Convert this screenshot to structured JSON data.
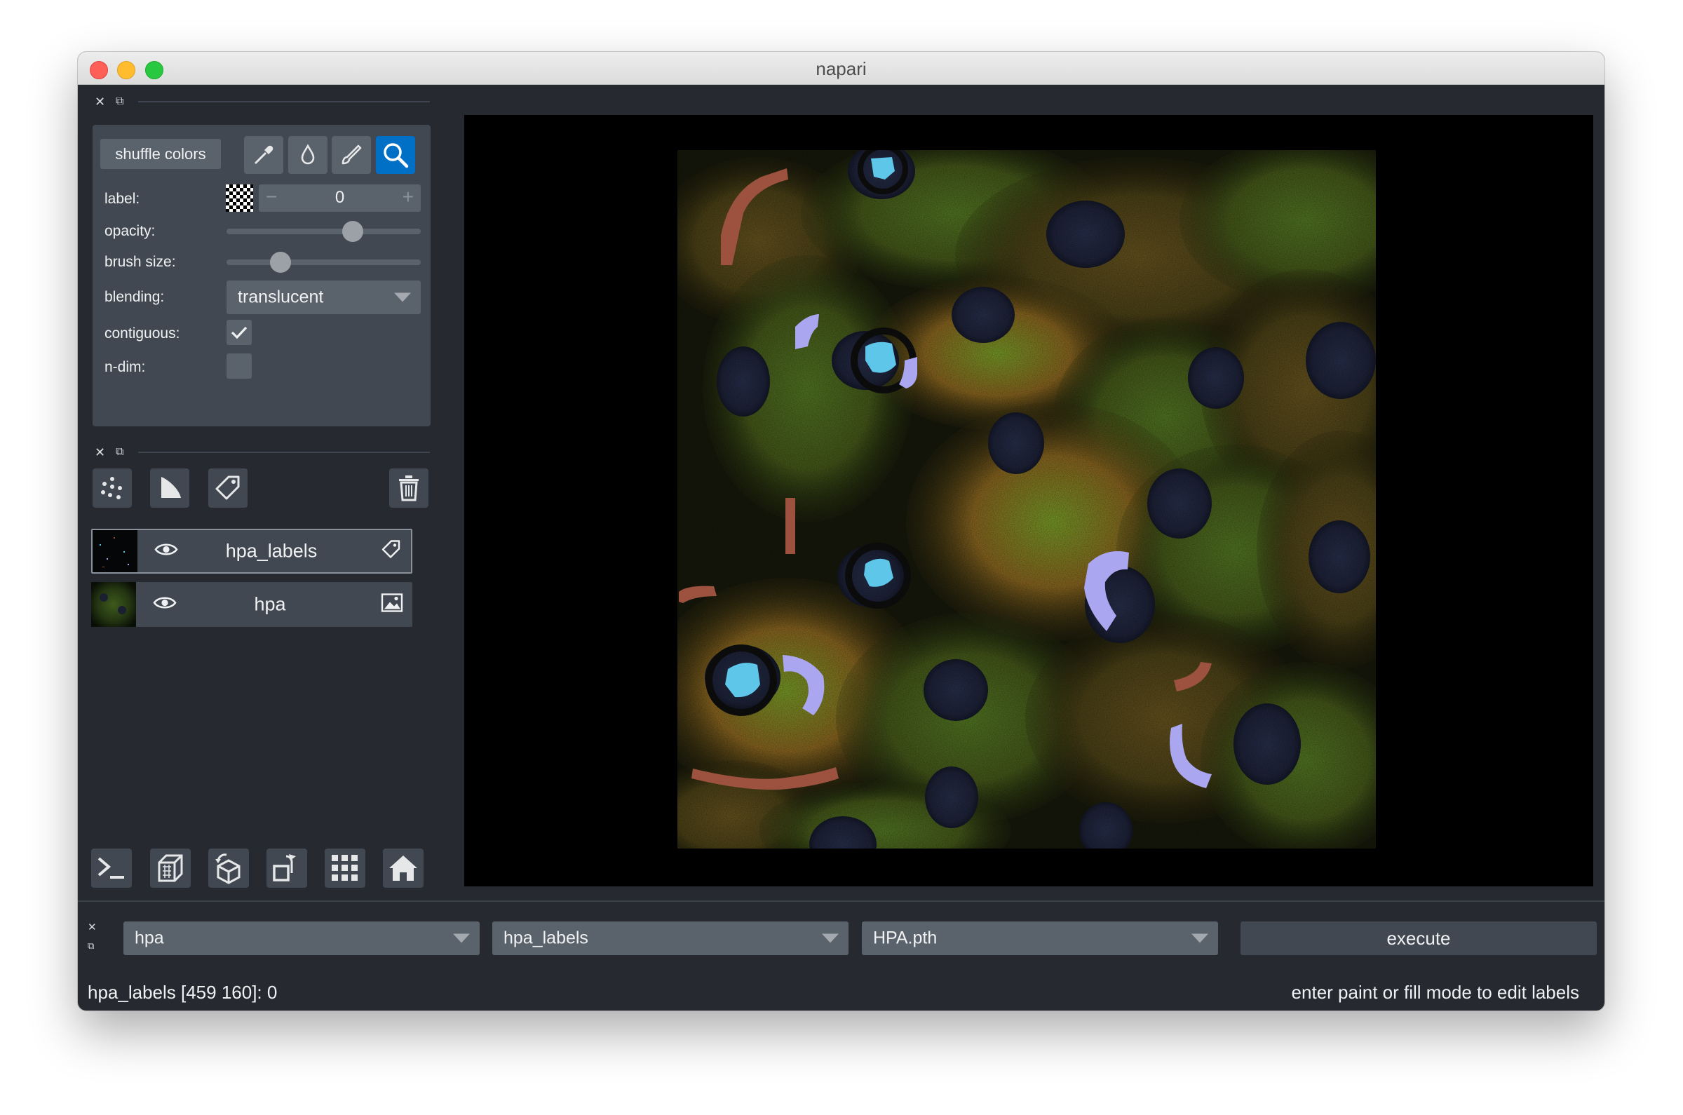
{
  "window": {
    "title": "napari"
  },
  "layer_controls": {
    "shuffle_label": "shuffle colors",
    "tools": [
      "picker-icon",
      "fill-icon",
      "paint-icon",
      "zoom-icon"
    ],
    "active_tool": "zoom-icon",
    "label_text": "label:",
    "label_value": "0",
    "opacity_text": "opacity:",
    "opacity_value": 0.67,
    "brush_text": "brush size:",
    "brush_value": 0.25,
    "blending_text": "blending:",
    "blending_value": "translucent",
    "contiguous_text": "contiguous:",
    "contiguous_checked": true,
    "ndim_text": "n-dim:",
    "ndim_checked": false
  },
  "layer_buttons": [
    "new-points-icon",
    "new-shapes-icon",
    "new-labels-icon",
    "delete-layer-icon"
  ],
  "layers": [
    {
      "name": "hpa_labels",
      "visible": true,
      "type_icon": "labels-icon",
      "selected": true
    },
    {
      "name": "hpa",
      "visible": true,
      "type_icon": "image-icon",
      "selected": false
    }
  ],
  "viewer_buttons": [
    "console-icon",
    "ndisplay-icon",
    "roll-dims-icon",
    "transpose-icon",
    "grid-icon",
    "home-icon"
  ],
  "plugin_widget": {
    "image_select": "hpa",
    "labels_select": "hpa_labels",
    "model_select": "HPA.pth",
    "execute_label": "execute"
  },
  "status": {
    "left": "hpa_labels [459 160]: 0",
    "right": "enter paint or fill mode to edit labels"
  },
  "colors": {
    "accent": "#0070c6",
    "panel": "#414851",
    "background": "#262930",
    "label_cyan": "#5ec6e8",
    "label_lavender": "#aaa6f0",
    "label_brown": "#9c523e"
  }
}
